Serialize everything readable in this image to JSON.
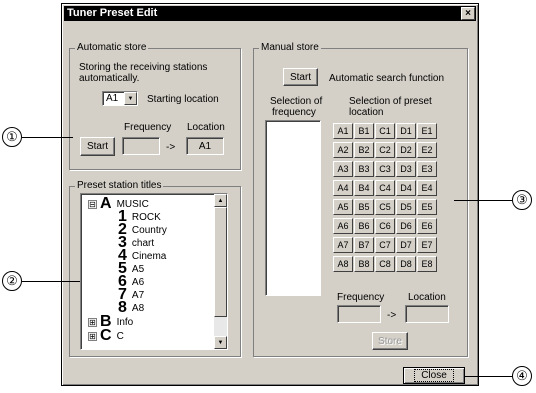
{
  "window": {
    "title": "Tuner Preset Edit",
    "close_glyph": "×"
  },
  "auto": {
    "legend": "Automatic store",
    "desc_line1": "Storing the receiving stations",
    "desc_line2": "automatically.",
    "location_select": "A1",
    "starting_location_label": "Starting location",
    "frequency_label": "Frequency",
    "location_label": "Location",
    "start_button": "Start",
    "frequency_value": "",
    "arrow": "->",
    "location_value": "A1"
  },
  "preset": {
    "legend": "Preset station titles",
    "tree": [
      {
        "expander": "⊟",
        "letter": "A",
        "label": "MUSIC"
      },
      {
        "number": "1",
        "label": "ROCK"
      },
      {
        "number": "2",
        "label": "Country"
      },
      {
        "number": "3",
        "label": "chart"
      },
      {
        "number": "4",
        "label": "Cinema"
      },
      {
        "number": "5",
        "label": "A5"
      },
      {
        "number": "6",
        "label": "A6"
      },
      {
        "number": "7",
        "label": "A7"
      },
      {
        "number": "8",
        "label": "A8"
      },
      {
        "expander": "⊞",
        "letter": "B",
        "label": "Info"
      },
      {
        "expander": "⊞",
        "letter": "C",
        "label": "C"
      }
    ]
  },
  "manual": {
    "legend": "Manual store",
    "start_button": "Start",
    "search_label": "Automatic search function",
    "selection_frequency_line1": "Selection of",
    "selection_frequency_line2": "frequency",
    "selection_preset_line1": "Selection of preset",
    "selection_preset_line2": "location",
    "presets": [
      "A1",
      "B1",
      "C1",
      "D1",
      "E1",
      "A2",
      "B2",
      "C2",
      "D2",
      "E2",
      "A3",
      "B3",
      "C3",
      "D3",
      "E3",
      "A4",
      "B4",
      "C4",
      "D4",
      "E4",
      "A5",
      "B5",
      "C5",
      "D5",
      "E5",
      "A6",
      "B6",
      "C6",
      "D6",
      "E6",
      "A7",
      "B7",
      "C7",
      "D7",
      "E7",
      "A8",
      "B8",
      "C8",
      "D8",
      "E8"
    ],
    "frequency_label": "Frequency",
    "location_label": "Location",
    "arrow": "->",
    "store_button": "Store"
  },
  "close_button": "Close",
  "callouts": [
    "①",
    "②",
    "③",
    "④"
  ]
}
